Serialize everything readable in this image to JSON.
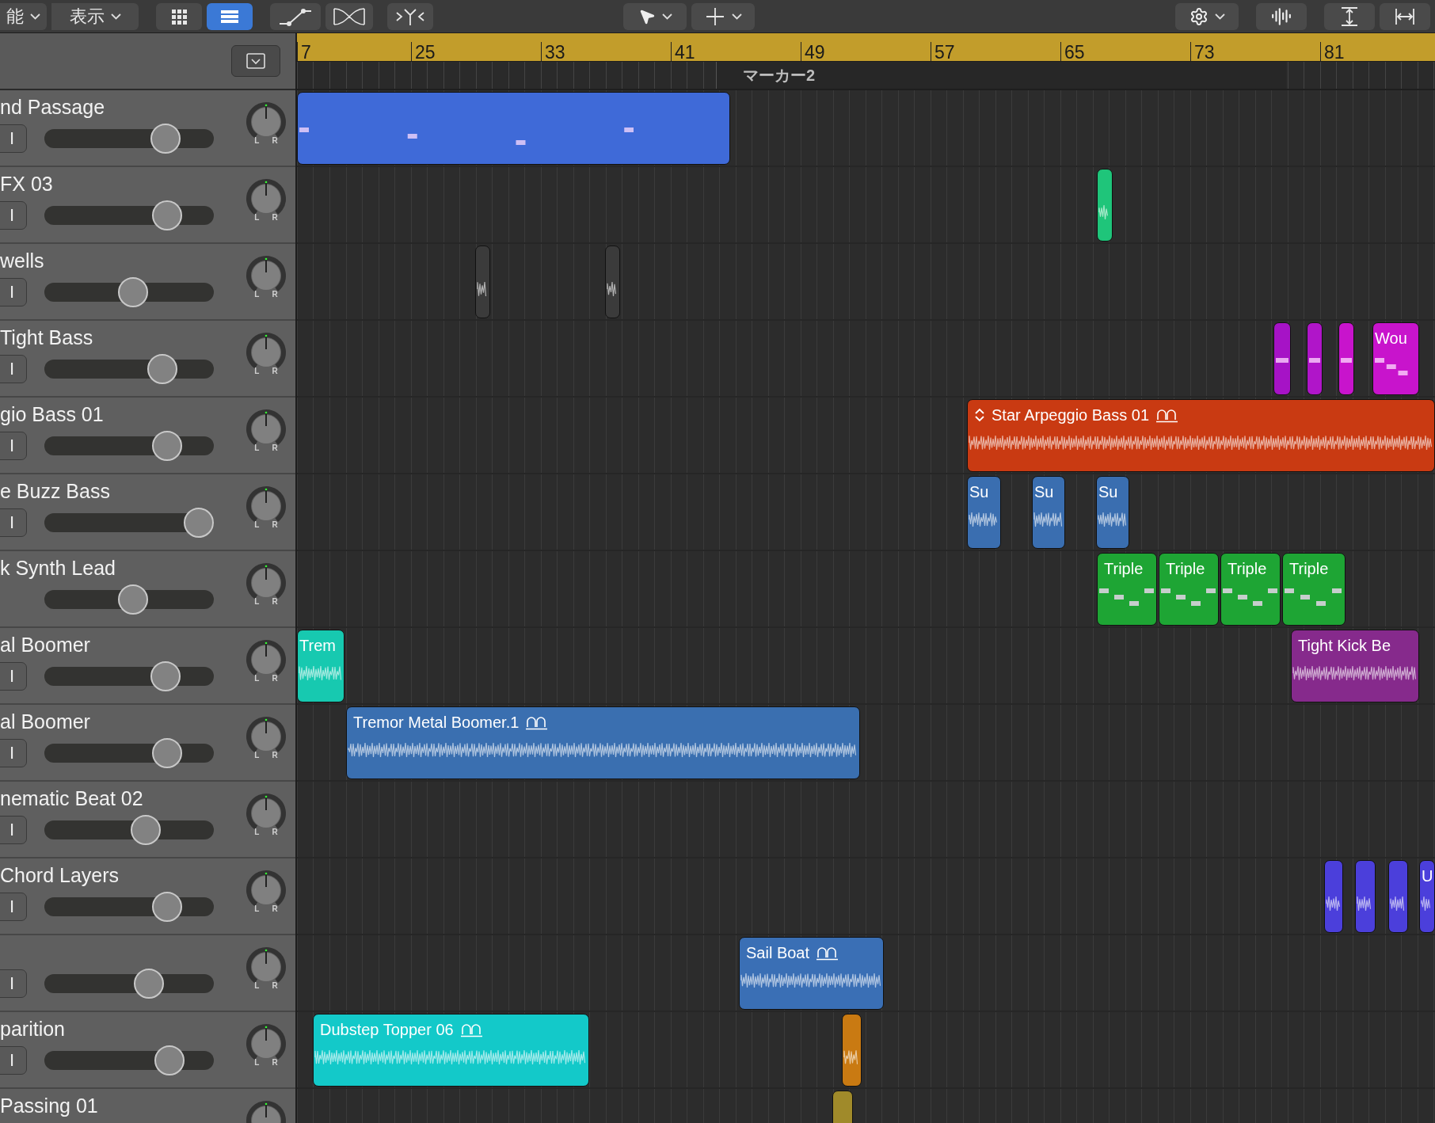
{
  "toolbar": {
    "menus": [
      {
        "label": "能"
      },
      {
        "label": "表示"
      }
    ],
    "view_buttons": [
      {
        "selected": false
      },
      {
        "selected": true
      }
    ]
  },
  "ruler": {
    "bars": [
      "7",
      "25",
      "33",
      "41",
      "49",
      "57",
      "65",
      "73",
      "81"
    ],
    "marker": "マーカー2"
  },
  "tracks": [
    {
      "name": "nd Passage",
      "input": "I",
      "fader": {
        "level": 0.76
      },
      "pan_labels": [
        "L",
        "R"
      ],
      "regions": [
        {
          "kind": "midi",
          "color": "#3f6ad8",
          "looped": false,
          "expandable": false
        }
      ]
    },
    {
      "name": "FX 03",
      "input": "I",
      "fader": {
        "level": 0.77
      },
      "pan_labels": [
        "L",
        "R"
      ],
      "regions": [
        {
          "kind": "audio",
          "color": "#1fc57a"
        }
      ]
    },
    {
      "name": "wells",
      "input": "I",
      "fader": {
        "level": 0.53
      },
      "pan_labels": [
        "L",
        "R"
      ],
      "regions": [
        {
          "kind": "audio",
          "color": "#3b3b3b"
        },
        {
          "kind": "audio",
          "color": "#3b3b3b"
        }
      ]
    },
    {
      "name": "Tight Bass",
      "input": "I",
      "fader": {
        "level": 0.74
      },
      "pan_labels": [
        "L",
        "R"
      ],
      "regions": [
        {
          "kind": "midi",
          "color": "#a613c6"
        },
        {
          "kind": "midi",
          "color": "#b015c9"
        },
        {
          "kind": "midi",
          "color": "#c814cc"
        },
        {
          "kind": "midi",
          "label": "Wou",
          "color": "#c814cc"
        }
      ]
    },
    {
      "name": "gio Bass 01",
      "input": "I",
      "fader": {
        "level": 0.77
      },
      "pan_labels": [
        "L",
        "R"
      ],
      "regions": [
        {
          "kind": "audio",
          "label": "Star Arpeggio Bass 01",
          "color": "#c93a12",
          "looped": true,
          "expandable": true
        }
      ]
    },
    {
      "name": "e Buzz Bass",
      "input": "I",
      "fader": {
        "level": 1.0
      },
      "pan_labels": [
        "L",
        "R"
      ],
      "regions": [
        {
          "kind": "audio",
          "label": "Su",
          "color": "#3a6eb0"
        },
        {
          "kind": "audio",
          "label": "Su",
          "color": "#3a6eb0"
        },
        {
          "kind": "audio",
          "label": "Su",
          "color": "#3a6eb0"
        }
      ]
    },
    {
      "name": "k Synth Lead",
      "fader": {
        "level": 0.53
      },
      "pan_labels": [
        "L",
        "R"
      ],
      "regions": [
        {
          "kind": "midi",
          "label": "Triple",
          "color": "#1ea534"
        },
        {
          "kind": "midi",
          "label": "Triple",
          "color": "#1ea534"
        },
        {
          "kind": "midi",
          "label": "Triple",
          "color": "#1ea534"
        },
        {
          "kind": "midi",
          "label": "Triple",
          "color": "#1ea534"
        }
      ]
    },
    {
      "name": "al Boomer",
      "input": "I",
      "fader": {
        "level": 0.76
      },
      "pan_labels": [
        "L",
        "R"
      ],
      "regions": [
        {
          "kind": "audio",
          "label": "Trem",
          "color": "#17c9b0"
        },
        {
          "kind": "audio",
          "label": "Tight Kick Be",
          "color": "#862a8c",
          "looped": false,
          "expandable": false
        }
      ]
    },
    {
      "name": "al Boomer",
      "input": "I",
      "fader": {
        "level": 0.77
      },
      "pan_labels": [
        "L",
        "R"
      ],
      "regions": [
        {
          "kind": "audio",
          "label": "Tremor Metal Boomer.1",
          "color": "#3a6fb0",
          "looped": true,
          "expandable": false
        }
      ]
    },
    {
      "name": "nematic Beat 02",
      "input": "I",
      "fader": {
        "level": 0.62
      },
      "pan_labels": [
        "L",
        "R"
      ]
    },
    {
      "name": "Chord Layers",
      "input": "I",
      "fader": {
        "level": 0.77
      },
      "pan_labels": [
        "L",
        "R"
      ],
      "regions": [
        {
          "kind": "audio",
          "color": "#4b3fdb"
        },
        {
          "kind": "audio",
          "color": "#4b3fdb"
        },
        {
          "kind": "audio",
          "color": "#4b3fdb"
        },
        {
          "kind": "audio",
          "label": "U",
          "color": "#4b3fdb"
        }
      ]
    },
    {
      "input": "I",
      "fader": {
        "level": 0.64
      },
      "pan_labels": [
        "L",
        "R"
      ],
      "regions": [
        {
          "kind": "audio",
          "label": "Sail Boat",
          "color": "#3a6fb5",
          "looped": true,
          "expandable": false
        }
      ]
    },
    {
      "name": "parition",
      "input": "I",
      "fader": {
        "level": 0.79
      },
      "pan_labels": [
        "L",
        "R"
      ],
      "regions": [
        {
          "kind": "audio",
          "label": "Dubstep Topper 06",
          "color": "#13c9c9",
          "looped": true,
          "expandable": false
        },
        {
          "kind": "audio",
          "color": "#c97a12"
        }
      ]
    },
    {
      "name": "Passing 01",
      "regions": [
        {
          "kind": "audio",
          "color": "#a08a2a"
        }
      ]
    }
  ]
}
